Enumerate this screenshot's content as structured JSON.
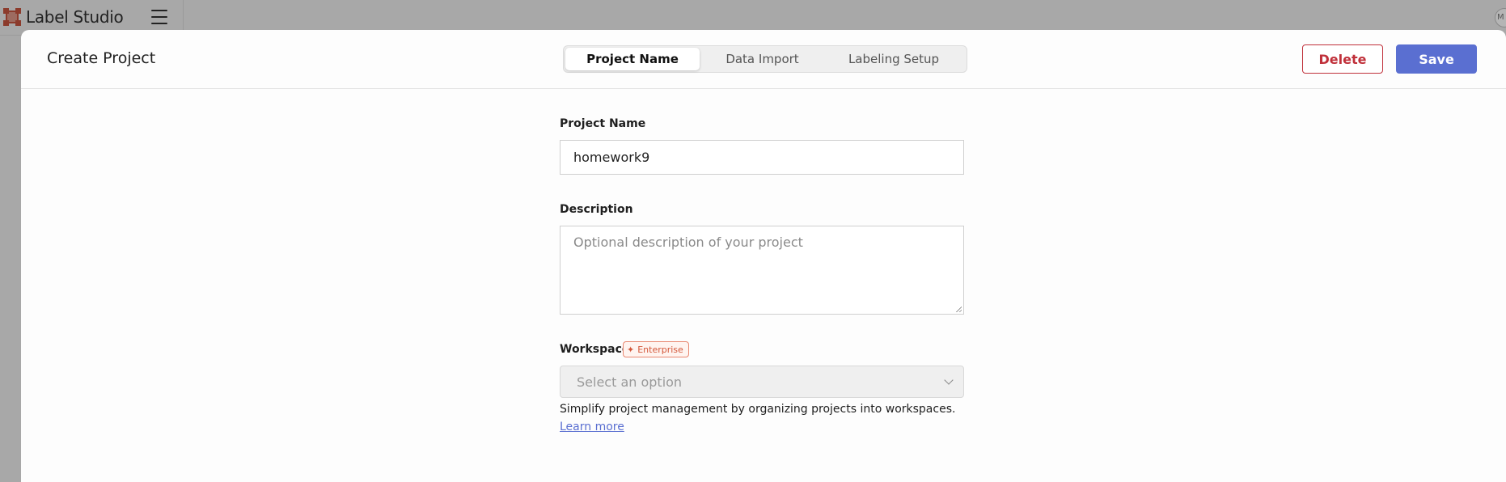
{
  "app": {
    "name": "Label Studio",
    "avatar_initial": "M"
  },
  "modal": {
    "title": "Create Project",
    "steps": [
      {
        "label": "Project Name",
        "active": true
      },
      {
        "label": "Data Import",
        "active": false
      },
      {
        "label": "Labeling Setup",
        "active": false
      }
    ],
    "delete_label": "Delete",
    "save_label": "Save"
  },
  "form": {
    "project_name": {
      "label": "Project Name",
      "value": "homework9"
    },
    "description": {
      "label": "Description",
      "placeholder": "Optional description of your project",
      "value": ""
    },
    "workspace": {
      "label": "Workspace",
      "badge": "Enterprise",
      "placeholder": "Select an option",
      "help_text": "Simplify project management by organizing projects into workspaces.",
      "learn_more": " Learn more"
    }
  },
  "colors": {
    "accent": "#5a6fd1",
    "danger": "#c0303a",
    "enterprise": "#d3573a",
    "logo": "#e34c32"
  }
}
